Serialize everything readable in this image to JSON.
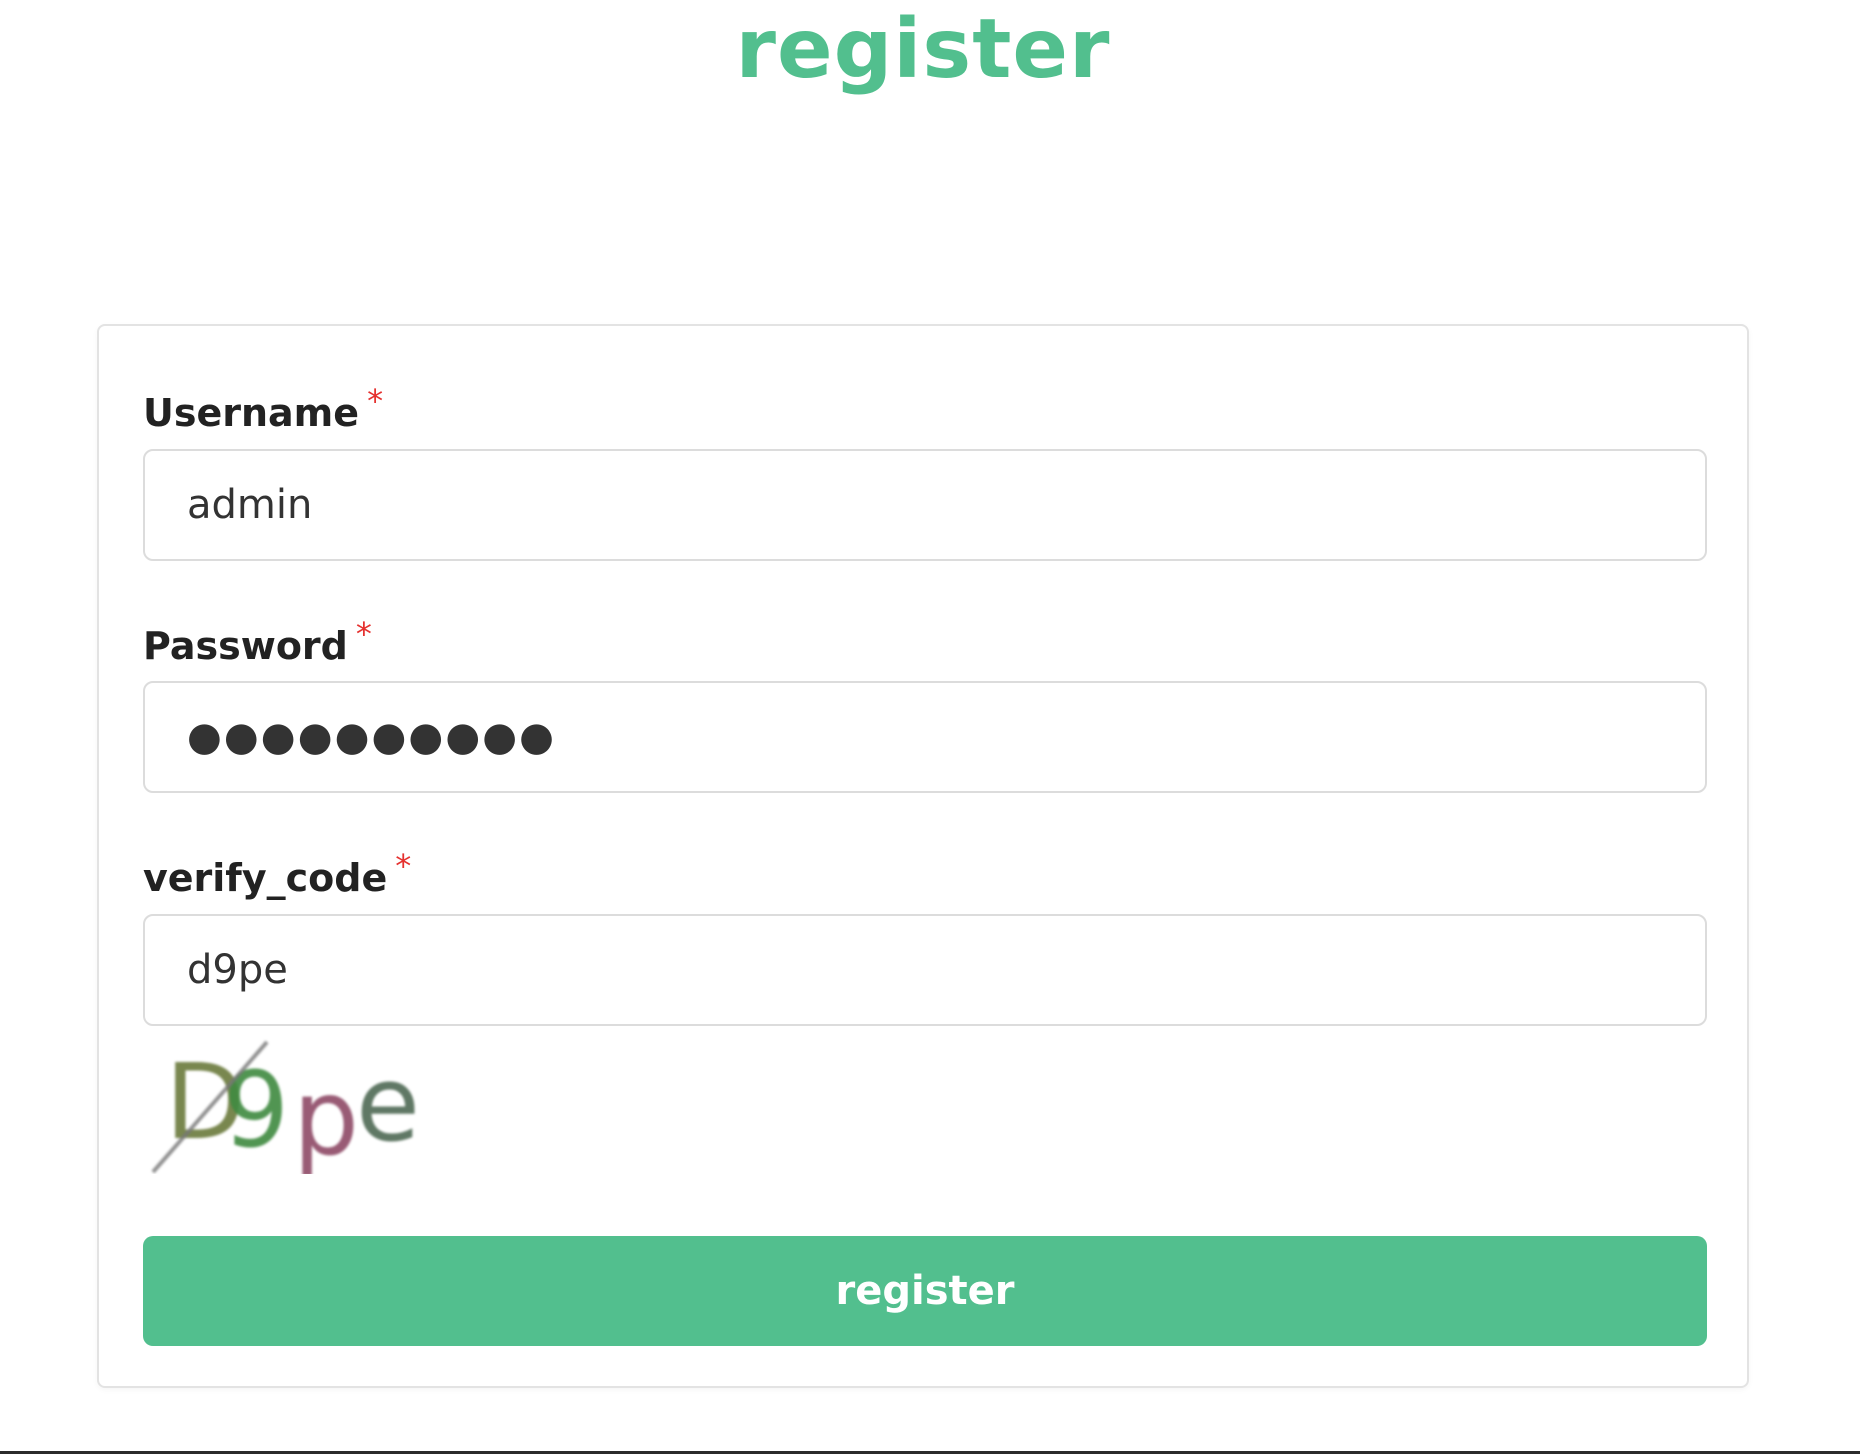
{
  "header": {
    "title": "register"
  },
  "form": {
    "username": {
      "label": "Username",
      "required_mark": "*",
      "value": "admin"
    },
    "password": {
      "label": "Password",
      "required_mark": "*",
      "value": "●●●●●●●●●●"
    },
    "verify_code": {
      "label": "verify_code",
      "required_mark": "*",
      "value": "d9pe"
    },
    "captcha": {
      "text": "D9pe"
    },
    "submit_label": "register"
  },
  "colors": {
    "accent": "#52bf8e",
    "required": "#e5312f",
    "label_text": "#222222",
    "input_border": "#dcdcdc"
  }
}
